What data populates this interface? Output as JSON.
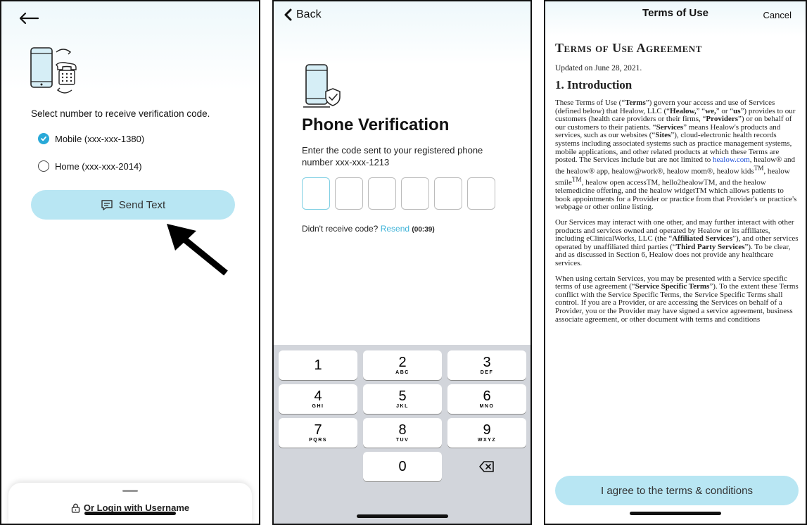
{
  "panel1": {
    "heading": "Select number to receive verification code.",
    "options": [
      {
        "label": "Mobile (xxx-xxx-1380)",
        "checked": true
      },
      {
        "label": "Home (xxx-xxx-2014)",
        "checked": false
      }
    ],
    "send_button": "Send Text",
    "login_link": "Or Login with Username"
  },
  "panel2": {
    "back_label": "Back",
    "title": "Phone Verification",
    "subtitle": "Enter the code sent to your registered phone number xxx-xxx-1213",
    "resend_prompt": "Didn't receive code?",
    "resend_link": "Resend",
    "timer": "(00:39)",
    "keys": [
      {
        "num": "1",
        "letters": ""
      },
      {
        "num": "2",
        "letters": "ABC"
      },
      {
        "num": "3",
        "letters": "DEF"
      },
      {
        "num": "4",
        "letters": "GHI"
      },
      {
        "num": "5",
        "letters": "JKL"
      },
      {
        "num": "6",
        "letters": "MNO"
      },
      {
        "num": "7",
        "letters": "PQRS"
      },
      {
        "num": "8",
        "letters": "TUV"
      },
      {
        "num": "9",
        "letters": "WXYZ"
      },
      {
        "num": "0",
        "letters": ""
      }
    ]
  },
  "panel3": {
    "header": "Terms of Use",
    "cancel": "Cancel",
    "doc_title": "Terms of Use Agreement",
    "updated": "Updated on June 28, 2021.",
    "section_title": "1. Introduction",
    "para1_a": "These Terms of Use (“",
    "para1_b": "Terms",
    "para1_c": "”) govern your access and use of Services (defined below) that Healow, LLC (“",
    "para1_d": "Healow,",
    "para1_e": "” “",
    "para1_f": "we,",
    "para1_g": "” or “",
    "para1_h": "us",
    "para1_i": "”) provides to our customers (health care providers or their firms, “",
    "para1_j": "Providers",
    "para1_k": "”) or on behalf of our customers to their patients. “",
    "para1_l": "Services",
    "para1_m": "” means Healow's products and services, such as our websites (“",
    "para1_n": "Sites",
    "para1_o": "”), cloud-electronic health records systems including associated systems such as practice management systems, mobile applications, and other related products at which these Terms are posted. The Services include but are not limited to ",
    "para1_link": "healow.com",
    "para1_p": ", healow® and the healow® app, healow@work®, healow mom®, healow kids",
    "tm1": "TM",
    "para1_q": ", healow smile",
    "tm2": "TM",
    "para1_r": ", healow open accessTM, hello2healowTM, and the healow telemedicine offering, and the healow widgetTM which allows patients to book appointments for a Provider or practice from that Provider's or practice's webpage or other online listing.",
    "para2_a": "Our Services may interact with one other, and may further interact with other products and services owned and operated by Healow or its affiliates, including eClinicalWorks, LLC (the “",
    "para2_b": "Affiliated Services",
    "para2_c": "”), and other services operated by unaffiliated third parties (“",
    "para2_d": "Third Party Services",
    "para2_e": "”). To be clear, and as discussed in Section 6, Healow does not provide any healthcare services.",
    "para3_a": "When using certain Services, you may be presented with a Service specific terms of use agreement (“",
    "para3_b": "Service Specific Terms",
    "para3_c": "”). To the extent these Terms conflict with the Service Specific Terms, the Service Specific Terms shall control. If you are a Provider, or are accessing the Services on behalf of a Provider, you or the Provider may have signed a service agreement, business associate agreement, or other document with terms and conditions",
    "agree_button": "I agree to the terms & conditions"
  }
}
